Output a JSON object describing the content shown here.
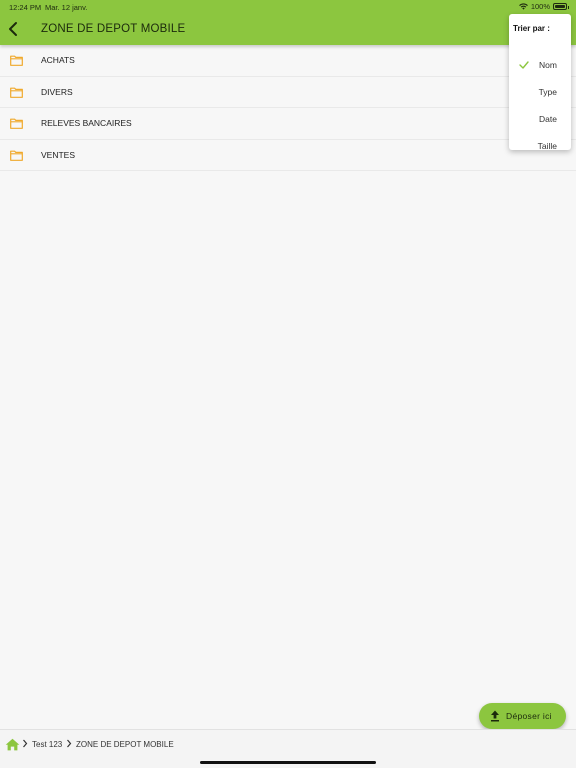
{
  "status_bar": {
    "time": "12:24 PM",
    "date": "Mar. 12 janv.",
    "battery": "100%"
  },
  "header": {
    "title": "ZONE DE DEPOT MOBILE"
  },
  "folders": [
    {
      "label": "ACHATS",
      "icon": "folder-icon"
    },
    {
      "label": "DIVERS",
      "icon": "folder-icon"
    },
    {
      "label": "RELEVES BANCAIRES",
      "icon": "folder-icon"
    },
    {
      "label": "VENTES",
      "icon": "folder-icon"
    }
  ],
  "sort_menu": {
    "title": "Trier par :",
    "options": [
      {
        "label": "Nom",
        "selected": true
      },
      {
        "label": "Type",
        "selected": false
      },
      {
        "label": "Date",
        "selected": false
      },
      {
        "label": "Taille",
        "selected": false
      }
    ]
  },
  "fab": {
    "label": "Déposer ici",
    "icon": "upload-icon"
  },
  "breadcrumb": {
    "items": [
      "Test 123",
      "ZONE DE DEPOT MOBILE"
    ],
    "home_icon": "home-icon"
  },
  "colors": {
    "accent": "#8cc63f",
    "folder": "#f0a92b",
    "background": "#f7f7f7"
  }
}
